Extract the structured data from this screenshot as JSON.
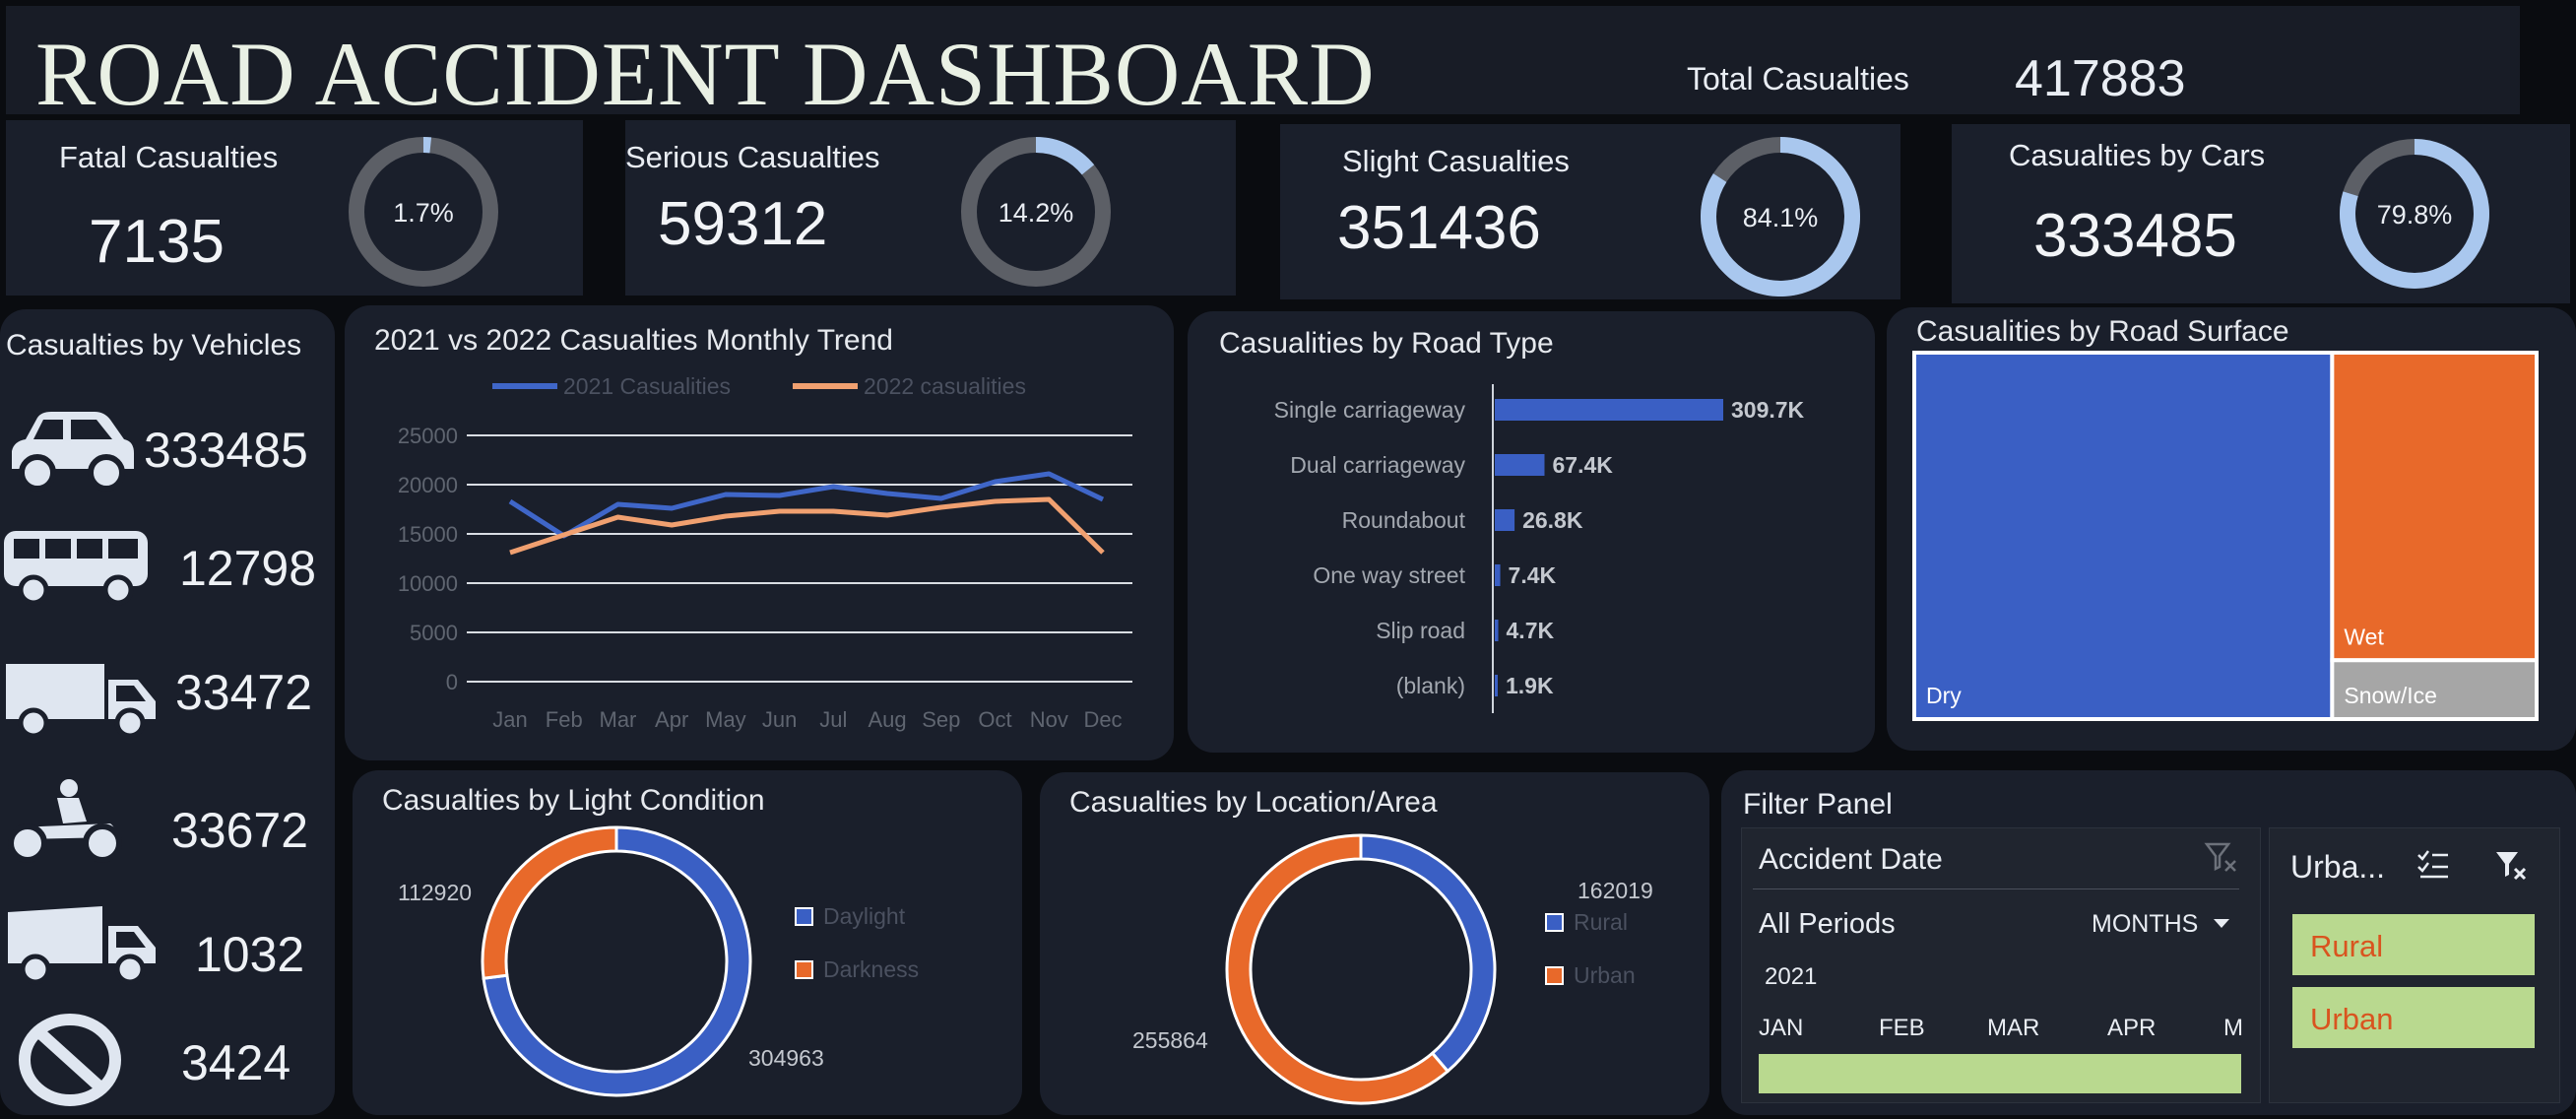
{
  "header": {
    "title": "ROAD ACCIDENT DASHBOARD",
    "total_label": "Total Casualties",
    "total_value": "417883"
  },
  "kpis": [
    {
      "label": "Fatal Casualties",
      "value": "7135",
      "pct_label": "1.7%",
      "pct": 1.7
    },
    {
      "label": "Serious Casualties",
      "value": "59312",
      "pct_label": "14.2%",
      "pct": 14.2
    },
    {
      "label": "Slight Casualties",
      "value": "351436",
      "pct_label": "84.1%",
      "pct": 84.1
    },
    {
      "label": "Casualties by Cars",
      "value": "333485",
      "pct_label": "79.8%",
      "pct": 79.8
    }
  ],
  "vehicles": {
    "title": "Casualties by Vehicles",
    "items": [
      {
        "icon": "car-icon",
        "value": "333485"
      },
      {
        "icon": "bus-icon",
        "value": "12798"
      },
      {
        "icon": "truck-icon",
        "value": "33472"
      },
      {
        "icon": "motorcycle-icon",
        "value": "33672"
      },
      {
        "icon": "dump-truck-icon",
        "value": "1032"
      },
      {
        "icon": "no-entry-icon",
        "value": "3424"
      }
    ]
  },
  "colors": {
    "blue": "#3a5fc4",
    "orange": "#e8692a",
    "light_blue": "#a9c7ee",
    "salmon": "#f0a070",
    "line_blue": "#3f66c8",
    "ring_gray": "#5c5f66",
    "panel": "#1a1f2b",
    "green_tile": "#b9d98f"
  },
  "chart_data": [
    {
      "type": "line",
      "title": "2021 vs 2022 Casualties Monthly Trend",
      "categories": [
        "Jan",
        "Feb",
        "Mar",
        "Apr",
        "May",
        "Jun",
        "Jul",
        "Aug",
        "Sep",
        "Oct",
        "Nov",
        "Dec"
      ],
      "series": [
        {
          "name": "2021 Casualities",
          "values": [
            18300,
            14800,
            18000,
            17600,
            19000,
            18900,
            19800,
            19100,
            18600,
            20300,
            21100,
            18500
          ]
        },
        {
          "name": "2022 casualities",
          "values": [
            13100,
            14900,
            16700,
            15900,
            16800,
            17300,
            17300,
            16900,
            17700,
            18300,
            18500,
            13100
          ]
        }
      ],
      "yticks": [
        "25000",
        "20000",
        "15000",
        "10000",
        "5000",
        "0"
      ],
      "ylim": [
        0,
        25000
      ],
      "grid": true,
      "legend": "top"
    },
    {
      "type": "bar",
      "title": "Casualities by Road Type",
      "categories": [
        "Single carriageway",
        "Dual carriageway",
        "Roundabout",
        "One way street",
        "Slip road",
        "(blank)"
      ],
      "values": [
        309.7,
        67.4,
        26.8,
        7.4,
        4.7,
        1.9
      ],
      "labels": [
        "309.7K",
        "67.4K",
        "26.8K",
        "7.4K",
        "4.7K",
        "1.9K"
      ],
      "orientation": "horizontal"
    },
    {
      "type": "treemap",
      "title": "Casualities by Road  Surface",
      "categories": [
        "Dry",
        "Wet",
        "Snow/Ice"
      ],
      "values": [
        280000,
        115000,
        22000
      ]
    },
    {
      "type": "pie",
      "title": "Casualties by Light Condition",
      "categories": [
        "Daylight",
        "Darkness"
      ],
      "values": [
        304963,
        112920
      ],
      "labels": [
        "304963",
        "112920"
      ]
    },
    {
      "type": "pie",
      "title": "Casualties by Location/Area",
      "categories": [
        "Rural",
        "Urban"
      ],
      "values": [
        162019,
        255864
      ],
      "labels": [
        "162019",
        "255864"
      ]
    }
  ],
  "filter": {
    "title": "Filter Panel",
    "date_title": "Accident Date",
    "periods": "All Periods",
    "granularity": "MONTHS",
    "year": "2021",
    "months": [
      "JAN",
      "FEB",
      "MAR",
      "APR",
      "M"
    ],
    "urban_title": "Urba...",
    "urban_items": [
      "Rural",
      "Urban"
    ]
  }
}
